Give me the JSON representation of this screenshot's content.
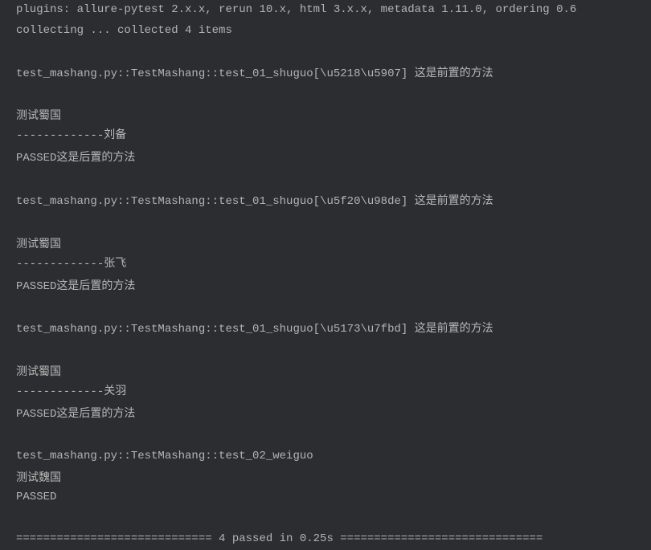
{
  "header": {
    "plugins_line": "plugins: allure-pytest 2.x.x, rerun 10.x, html 3.x.x, metadata 1.11.0, ordering 0.6",
    "collecting_line": "collecting ... collected 4 items"
  },
  "test_blocks": [
    {
      "test_id": "test_mashang.py::TestMashang::test_01_shuguo[\\u5218\\u5907] ",
      "prefix_msg": "这是前置的方法",
      "blank1": "",
      "body_line1": "测试蜀国",
      "body_line2": "-------------刘备",
      "result_prefix": "PASSED",
      "suffix_msg": "这是后置的方法",
      "blank2": ""
    },
    {
      "test_id": "test_mashang.py::TestMashang::test_01_shuguo[\\u5f20\\u98de] ",
      "prefix_msg": "这是前置的方法",
      "blank1": "",
      "body_line1": "测试蜀国",
      "body_line2": "-------------张飞",
      "result_prefix": "PASSED",
      "suffix_msg": "这是后置的方法",
      "blank2": ""
    },
    {
      "test_id": "test_mashang.py::TestMashang::test_01_shuguo[\\u5173\\u7fbd] ",
      "prefix_msg": "这是前置的方法",
      "blank1": "",
      "body_line1": "测试蜀国",
      "body_line2": "-------------关羽",
      "result_prefix": "PASSED",
      "suffix_msg": "这是后置的方法",
      "blank2": ""
    }
  ],
  "test_block_4": {
    "test_id": "test_mashang.py::TestMashang::test_02_weiguo ",
    "body_line1": "测试魏国",
    "result_prefix": "PASSED"
  },
  "summary": {
    "line": "============================= 4 passed in 0.25s =============================="
  }
}
